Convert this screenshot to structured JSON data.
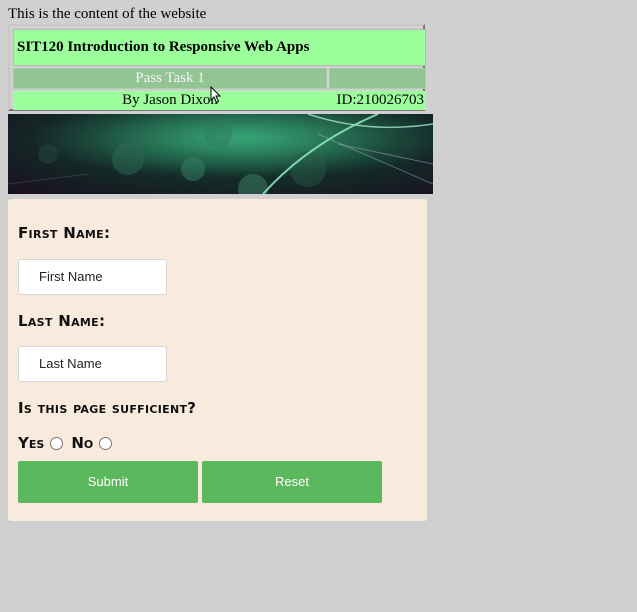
{
  "intro_text": "This is the content of the website",
  "header": {
    "course_title": "SIT120 Introduction to Responsive Web Apps",
    "task": "Pass Task 1",
    "author": "By Jason Dixon",
    "student_id": "ID:210026703"
  },
  "form": {
    "first_name_label": "First Name:",
    "first_name_placeholder": "First Name",
    "last_name_label": "Last Name:",
    "last_name_placeholder": "Last Name",
    "question": "Is this page sufficient?",
    "yes_label": "Yes",
    "no_label": "No",
    "submit_label": "Submit",
    "reset_label": "Reset"
  },
  "colors": {
    "page_background": "#d0d0d0",
    "header_green": "#9cff9c",
    "form_background": "#f8eadc",
    "button_green": "#5cb85c"
  }
}
